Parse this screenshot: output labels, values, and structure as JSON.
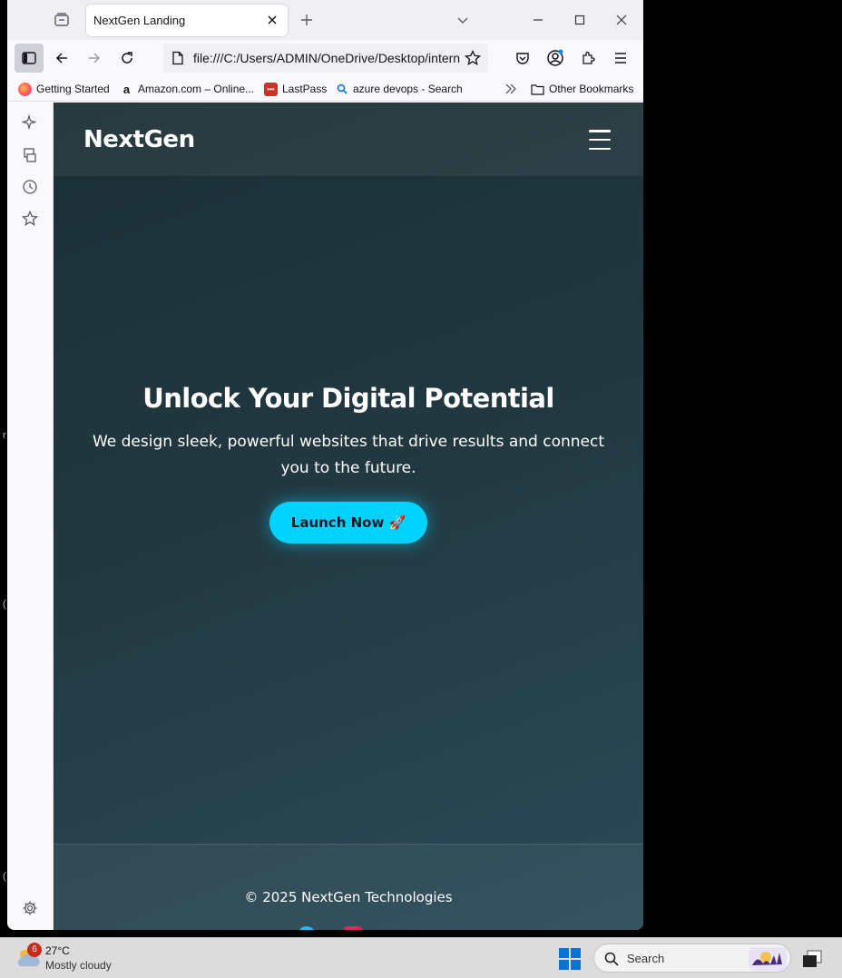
{
  "browser": {
    "tab_title": "NextGen Landing",
    "url": "file:///C:/Users/ADMIN/OneDrive/Desktop/internship/index.html",
    "bookmarks": [
      {
        "label": "Getting Started",
        "icon": "firefox-icon"
      },
      {
        "label": "Amazon.com – Online...",
        "icon": "amazon-icon"
      },
      {
        "label": "LastPass",
        "icon": "lastpass-icon"
      },
      {
        "label": "azure devops - Search",
        "icon": "search-icon"
      }
    ],
    "other_bookmarks": "Other Bookmarks"
  },
  "page": {
    "logo": "NextGen",
    "hero_title": "Unlock Your Digital Potential",
    "hero_subtitle": "We design sleek, powerful websites that drive results and connect you to the future.",
    "cta_label": "Launch Now 🚀",
    "footer_text": "© 2025 NextGen Technologies",
    "colors": {
      "accent": "#00d2ff",
      "background": "#203a43",
      "text": "#ffffff"
    }
  },
  "taskbar": {
    "weather_badge": "6",
    "weather_temp": "27°C",
    "weather_desc": "Mostly cloudy",
    "search_placeholder": "Search"
  }
}
